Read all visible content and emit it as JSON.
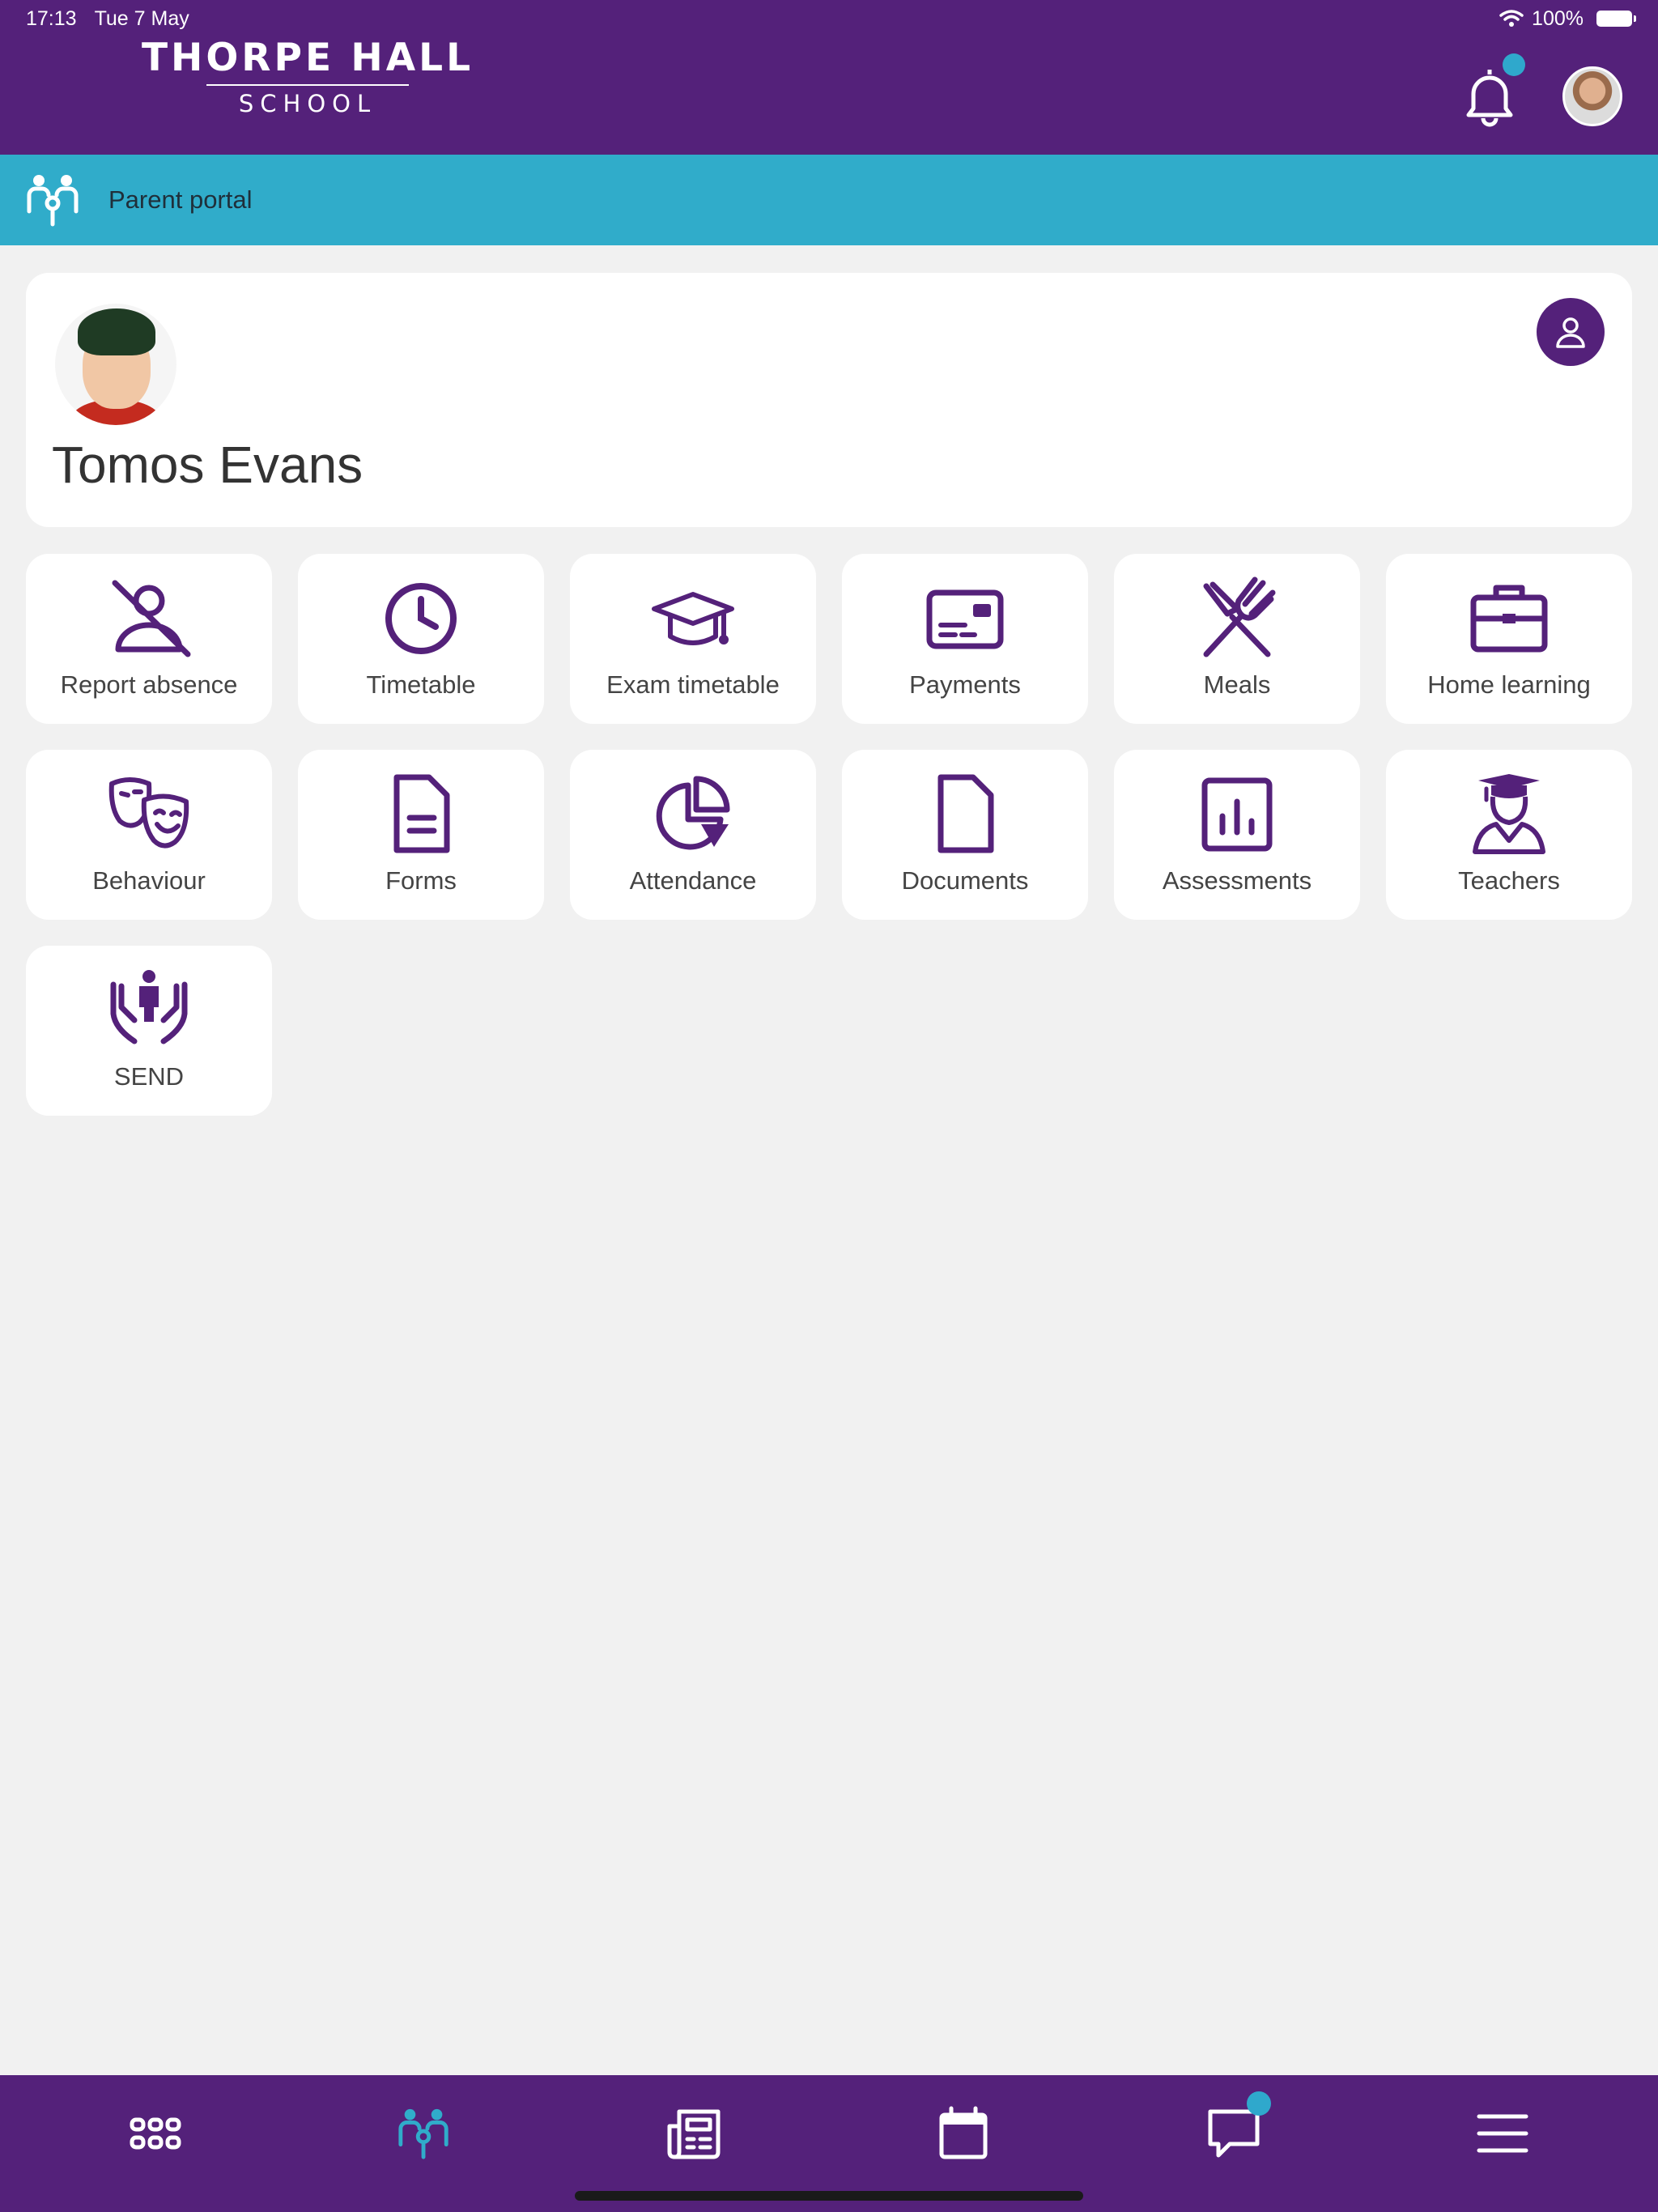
{
  "status_bar": {
    "time": "17:13",
    "date": "Tue 7 May",
    "battery": "100%"
  },
  "header": {
    "logo_line1": "THORPE HALL",
    "logo_line2": "SCHOOL",
    "notification_badge": true
  },
  "section": {
    "label": "Parent portal"
  },
  "student": {
    "name": "Tomos Evans"
  },
  "tiles": [
    {
      "label": "Report absence",
      "icon": "person-off-icon"
    },
    {
      "label": "Timetable",
      "icon": "clock-icon"
    },
    {
      "label": "Exam timetable",
      "icon": "graduation-cap-icon"
    },
    {
      "label": "Payments",
      "icon": "payment-card-icon"
    },
    {
      "label": "Meals",
      "icon": "cutlery-icon"
    },
    {
      "label": "Home learning",
      "icon": "briefcase-icon"
    },
    {
      "label": "Behaviour",
      "icon": "theatre-masks-icon"
    },
    {
      "label": "Forms",
      "icon": "form-document-icon"
    },
    {
      "label": "Attendance",
      "icon": "pie-chart-icon"
    },
    {
      "label": "Documents",
      "icon": "document-icon"
    },
    {
      "label": "Assessments",
      "icon": "bar-chart-icon"
    },
    {
      "label": "Teachers",
      "icon": "teacher-icon"
    },
    {
      "label": "SEND",
      "icon": "care-hands-icon"
    }
  ],
  "bottom_nav": [
    {
      "name": "apps-grid-icon",
      "active": false
    },
    {
      "name": "family-icon",
      "active": true
    },
    {
      "name": "news-icon",
      "active": false
    },
    {
      "name": "calendar-icon",
      "active": false
    },
    {
      "name": "chat-icon",
      "active": false,
      "badge": true
    },
    {
      "name": "menu-icon",
      "active": false
    }
  ],
  "colors": {
    "primary": "#54217a",
    "accent": "#30acca",
    "background": "#f1f1f1",
    "badge": "#2fa8cc"
  }
}
